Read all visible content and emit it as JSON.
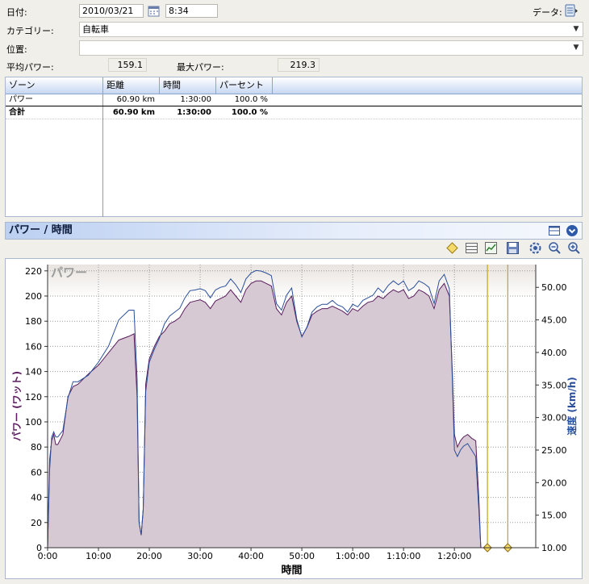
{
  "header": {
    "date_label": "日付:",
    "date_value": "2010/03/21",
    "time_value": "8:34",
    "data_label": "データ:",
    "category_label": "カテゴリー:",
    "category_value": "自転車",
    "location_label": "位置:",
    "location_value": "",
    "avg_power_label": "平均パワー:",
    "avg_power_value": "159.1",
    "max_power_label": "最大パワー:",
    "max_power_value": "219.3"
  },
  "zones": {
    "columns": [
      "ゾーン",
      "距離",
      "時間",
      "パーセント"
    ],
    "rows": [
      {
        "zone": "パワー",
        "distance": "60.90 km",
        "time": "1:30:00",
        "percent": "100.0 %"
      }
    ],
    "total": {
      "zone": "合計",
      "distance": "60.90 km",
      "time": "1:30:00",
      "percent": "100.0 %"
    }
  },
  "chart_panel": {
    "title": "パワー / 時間",
    "toolbar_icons": [
      "diamond-marker-icon",
      "grid-icon",
      "chart-icon",
      "save-icon",
      "settings-icon",
      "zoom-out-icon",
      "zoom-in-icon"
    ],
    "header_icons": [
      "layout-icon",
      "collapse-icon"
    ]
  },
  "chart_data": {
    "type": "area",
    "watermark": "パワー",
    "xlabel": "時間",
    "ylabel_left": "パワー (ワット)",
    "ylabel_right": "速度 (km/h)",
    "x_unit": "minutes",
    "xlim": [
      0,
      96
    ],
    "ylim_left": [
      0,
      225
    ],
    "ylim_right": [
      10,
      53.5
    ],
    "x_ticks": [
      "0:00",
      "10:00",
      "20:00",
      "30:00",
      "40:00",
      "50:00",
      "1:00:00",
      "1:10:00",
      "1:20:00"
    ],
    "y_ticks_left": [
      0,
      20,
      40,
      60,
      80,
      100,
      120,
      140,
      160,
      180,
      200,
      220
    ],
    "y_ticks_right": [
      "10.00",
      "15.00",
      "20.00",
      "25.00",
      "30.00",
      "35.00",
      "40.00",
      "45.00",
      "50.00"
    ],
    "grid": true,
    "colors": {
      "power_fill": "#d6c9d3",
      "power_line": "#5a1e5e",
      "speed_line": "#2a4f9a",
      "marker_line": "#c7a11d"
    },
    "markers_minutes": [
      86.5,
      90.5
    ],
    "series": [
      {
        "name": "パワー",
        "axis": "left",
        "x": [
          0,
          0.4,
          0.8,
          1.2,
          1.6,
          2,
          3,
          4,
          5,
          6,
          8,
          10,
          12,
          14,
          16,
          17,
          17.6,
          18,
          18.4,
          18.8,
          19.3,
          20,
          21,
          22,
          23,
          24,
          25,
          26,
          27,
          28,
          29,
          30,
          31,
          32,
          33,
          34,
          35,
          36,
          37,
          38,
          39,
          40,
          41,
          42,
          43,
          44,
          45,
          46,
          47,
          48,
          49,
          50,
          51,
          52,
          53,
          54,
          55,
          56,
          57,
          58,
          59,
          60,
          61,
          62,
          63,
          64,
          65,
          66,
          67,
          68,
          69,
          70,
          71,
          72,
          73,
          74,
          75,
          76,
          77,
          78,
          79,
          79.6,
          80,
          80.6,
          81.2,
          81.8,
          82.6,
          83.4,
          84.2,
          84.8,
          85.2
        ],
        "values": [
          0,
          70,
          85,
          90,
          82,
          82,
          90,
          120,
          128,
          130,
          138,
          145,
          155,
          165,
          168,
          170,
          120,
          20,
          10,
          30,
          130,
          150,
          160,
          168,
          172,
          178,
          180,
          183,
          190,
          195,
          196,
          197,
          195,
          190,
          196,
          198,
          200,
          205,
          200,
          195,
          205,
          210,
          212,
          212,
          210,
          208,
          190,
          185,
          195,
          200,
          180,
          168,
          175,
          185,
          188,
          190,
          190,
          192,
          190,
          188,
          185,
          190,
          188,
          192,
          195,
          196,
          200,
          198,
          202,
          205,
          203,
          205,
          198,
          200,
          205,
          203,
          200,
          190,
          205,
          210,
          200,
          140,
          90,
          80,
          85,
          88,
          90,
          87,
          85,
          40,
          0
        ]
      },
      {
        "name": "速度",
        "axis": "right",
        "x": [
          0,
          0.4,
          0.8,
          1.2,
          1.6,
          2,
          3,
          4,
          5,
          6,
          8,
          10,
          12,
          14,
          16,
          17,
          17.6,
          18,
          18.4,
          18.8,
          19.3,
          20,
          21,
          22,
          23,
          24,
          25,
          26,
          27,
          28,
          29,
          30,
          31,
          32,
          33,
          34,
          35,
          36,
          37,
          38,
          39,
          40,
          41,
          42,
          43,
          44,
          45,
          46,
          47,
          48,
          49,
          50,
          51,
          52,
          53,
          54,
          55,
          56,
          57,
          58,
          59,
          60,
          61,
          62,
          63,
          64,
          65,
          66,
          67,
          68,
          69,
          70,
          71,
          72,
          73,
          74,
          75,
          76,
          77,
          78,
          79,
          79.6,
          80,
          80.6,
          81.2,
          81.8,
          82.6,
          83.4,
          84.2,
          84.8,
          85.2
        ],
        "values": [
          10,
          22,
          27,
          27.8,
          27,
          27,
          28,
          33,
          35.5,
          35.5,
          36.5,
          38.5,
          41,
          45,
          46.5,
          46.5,
          36,
          14,
          12,
          16,
          34,
          38.5,
          40.5,
          42.2,
          44.4,
          45.6,
          46.2,
          46.8,
          48.4,
          49.5,
          49.6,
          49.8,
          49.5,
          48.4,
          49.6,
          50,
          50.2,
          51.3,
          50.4,
          49.2,
          51.3,
          52.2,
          52.6,
          52.5,
          52.2,
          51.8,
          47.5,
          46.5,
          48.8,
          49.9,
          45.1,
          42.4,
          43.9,
          46.2,
          47,
          47.4,
          47.4,
          48,
          47.3,
          47,
          46.2,
          47.4,
          47,
          48,
          48.4,
          48.8,
          49.9,
          49.2,
          50.3,
          51,
          50.4,
          51,
          49.5,
          50,
          51,
          50.6,
          50,
          47.5,
          51,
          52,
          49.8,
          36,
          25,
          24,
          25,
          25.6,
          26,
          25,
          24,
          16,
          10
        ]
      }
    ]
  }
}
